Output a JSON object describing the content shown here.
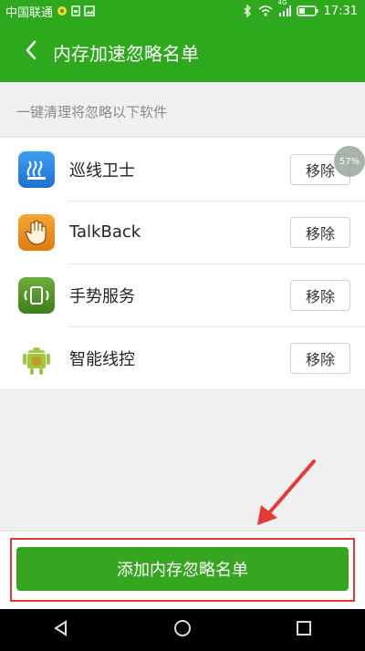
{
  "status_bar": {
    "carrier": "中国联通",
    "time": "17:31",
    "signal_label": "4G"
  },
  "header": {
    "title": "内存加速忽略名单"
  },
  "section": {
    "label": "一键清理将忽略以下软件"
  },
  "apps": [
    {
      "name": "巡线卫士",
      "remove_label": "移除",
      "icon": "xunxian-weishi-icon"
    },
    {
      "name": "TalkBack",
      "remove_label": "移除",
      "icon": "talkback-hand-icon"
    },
    {
      "name": "手势服务",
      "remove_label": "移除",
      "icon": "gesture-service-icon"
    },
    {
      "name": "智能线控",
      "remove_label": "移除",
      "icon": "android-robot-icon"
    }
  ],
  "float_bubble": {
    "text": "57%"
  },
  "footer": {
    "add_button_label": "添加内存忽略名单"
  },
  "colors": {
    "primary": "#2ea81c",
    "button_green": "#36a51f",
    "annotation_red": "#e53935"
  }
}
